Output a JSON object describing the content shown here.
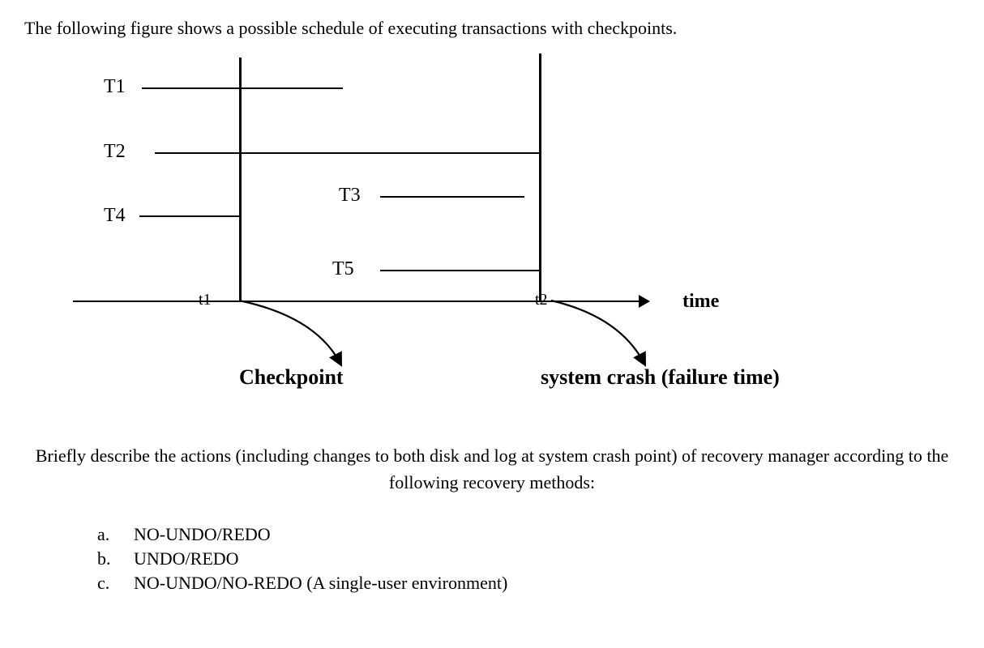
{
  "intro": "The following figure shows a possible schedule of executing transactions with checkpoints.",
  "figure": {
    "transactions": {
      "T1": "T1",
      "T2": "T2",
      "T3": "T3",
      "T4": "T4",
      "T5": "T5"
    },
    "ticks": {
      "t1": "t1",
      "t2": "t2"
    },
    "axis_label": "time",
    "checkpoint_label": "Checkpoint",
    "crash_label": "system crash (failure time)"
  },
  "question": "Briefly describe the actions (including changes to both disk and log at system crash point) of recovery manager according to the following recovery methods:",
  "options": [
    {
      "letter": "a.",
      "text": "NO-UNDO/REDO"
    },
    {
      "letter": "b.",
      "text": "UNDO/REDO"
    },
    {
      "letter": "c.",
      "text": "NO-UNDO/NO-REDO (A single-user environment)"
    }
  ],
  "chart_data": {
    "type": "timeline",
    "events": [
      {
        "name": "checkpoint",
        "time": "t1"
      },
      {
        "name": "system_crash",
        "time": "t2"
      }
    ],
    "transactions": [
      {
        "id": "T1",
        "start": "before_t1",
        "end": "between_t1_t2_early",
        "status": "committed_before_crash"
      },
      {
        "id": "T2",
        "start": "before_t1",
        "end": "at_t2",
        "status": "active_at_crash"
      },
      {
        "id": "T3",
        "start": "between_t1_t2",
        "end": "before_t2",
        "status": "committed_before_crash"
      },
      {
        "id": "T4",
        "start": "before_t1",
        "end": "at_t1",
        "status": "committed_at_checkpoint"
      },
      {
        "id": "T5",
        "start": "between_t1_t2",
        "end": "at_t2",
        "status": "active_at_crash"
      }
    ]
  }
}
